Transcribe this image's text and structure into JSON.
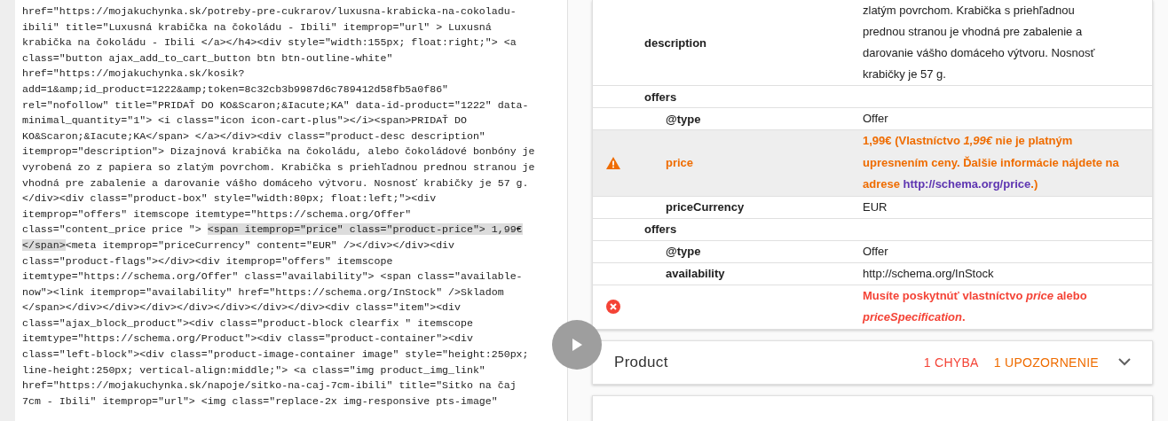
{
  "source_code": {
    "lines": [
      {
        "parts": [
          {
            "text": "href=\"https://mojakuchynka.sk/potreby-pre-cukrarov/luxusna-krabicka-na-cokoladu-",
            "highlighted": false
          }
        ]
      },
      {
        "parts": [
          {
            "text": "ibili\" title=\"Luxusná krabička na čokoládu - Ibili\" itemprop=\"url\" > Luxusná",
            "highlighted": false
          }
        ]
      },
      {
        "parts": [
          {
            "text": "krabička na čokoládu - Ibili </a></h4><div style=\"width:155px; float:right;\"> <a",
            "highlighted": false
          }
        ]
      },
      {
        "parts": [
          {
            "text": "class=\"button ajax_add_to_cart_button btn btn-outline-white\"",
            "highlighted": false
          }
        ]
      },
      {
        "parts": [
          {
            "text": "href=\"https://mojakuchynka.sk/kosik?",
            "highlighted": false
          }
        ]
      },
      {
        "parts": [
          {
            "text": "add=1&amp;id_product=1222&amp;token=8c32cb3b9987d6c789412d58fb5a0f86\"",
            "highlighted": false
          }
        ]
      },
      {
        "parts": [
          {
            "text": "rel=\"nofollow\" title=\"PRIDAŤ DO KO&Scaron;&Iacute;KA\" data-id-product=\"1222\" data-",
            "highlighted": false
          }
        ]
      },
      {
        "parts": [
          {
            "text": "minimal_quantity=\"1\"> <i class=\"icon icon-cart-plus\"></i><span>PRIDAŤ DO",
            "highlighted": false
          }
        ]
      },
      {
        "parts": [
          {
            "text": "KO&Scaron;&Iacute;KA</span> </a></div><div class=\"product-desc description\"",
            "highlighted": false
          }
        ]
      },
      {
        "parts": [
          {
            "text": "itemprop=\"description\"> Dizajnová krabička na čokoládu, alebo čokoládové bonbóny je",
            "highlighted": false
          }
        ]
      },
      {
        "parts": [
          {
            "text": "vyrobená zo z papiera so zlatým povrchom. Krabička s priehľadnou prednou stranou je",
            "highlighted": false
          }
        ]
      },
      {
        "parts": [
          {
            "text": "vhodná pre zabalenie a darovanie vášho domáceho výtvoru. Nosnosť krabičky je 57 g.",
            "highlighted": false
          }
        ]
      },
      {
        "parts": [
          {
            "text": "</div><div class=\"product-box\" style=\"width:80px; float:left;\"><div",
            "highlighted": false
          }
        ]
      },
      {
        "parts": [
          {
            "text": "itemprop=\"offers\" itemscope itemtype=\"https://schema.org/Offer\"",
            "highlighted": false
          }
        ]
      },
      {
        "parts": [
          {
            "text": "class=\"content_price price \"> ",
            "highlighted": false
          },
          {
            "text": "<span itemprop=\"price\" class=\"product-price\"> 1,99€",
            "highlighted": true
          }
        ]
      },
      {
        "parts": [
          {
            "text": "</span>",
            "highlighted": true
          },
          {
            "text": "<meta itemprop=\"priceCurrency\" content=\"EUR\" /></div></div><div",
            "highlighted": false
          }
        ]
      },
      {
        "parts": [
          {
            "text": "class=\"product-flags\"></div><div itemprop=\"offers\" itemscope",
            "highlighted": false
          }
        ]
      },
      {
        "parts": [
          {
            "text": "itemtype=\"https://schema.org/Offer\" class=\"availability\"> <span class=\"available-",
            "highlighted": false
          }
        ]
      },
      {
        "parts": [
          {
            "text": "now\"><link itemprop=\"availability\" href=\"https://schema.org/InStock\" />Skladom",
            "highlighted": false
          }
        ]
      },
      {
        "parts": [
          {
            "text": "</span></div></div></div></div></div></div></div><div class=\"item\"><div",
            "highlighted": false
          }
        ]
      },
      {
        "parts": [
          {
            "text": "class=\"ajax_block_product\"><div class=\"product-block clearfix \" itemscope",
            "highlighted": false
          }
        ]
      },
      {
        "parts": [
          {
            "text": "itemtype=\"https://schema.org/Product\"><div class=\"product-container\"><div",
            "highlighted": false
          }
        ]
      },
      {
        "parts": [
          {
            "text": "class=\"left-block\"><div class=\"product-image-container image\" style=\"height:250px;",
            "highlighted": false
          }
        ]
      },
      {
        "parts": [
          {
            "text": "line-height:250px; vertical-align:middle;\"> <a class=\"img product_img_link\"",
            "highlighted": false
          }
        ]
      },
      {
        "parts": [
          {
            "text": "href=\"https://mojakuchynka.sk/napoje/sitko-na-caj-7cm-ibili\" title=\"Sitko na čaj",
            "highlighted": false
          }
        ]
      },
      {
        "parts": [
          {
            "text": "7cm - Ibili\" itemprop=\"url\"> <img class=\"replace-2x img-responsive pts-image\"",
            "highlighted": false
          }
        ]
      }
    ]
  },
  "results": {
    "rows": [
      {
        "kind": "property",
        "name": "description",
        "value": "zlatým povrchom. Krabička s priehľadnou prednou stranou je vhodná pre zabalenie a darovanie vášho domáceho výtvoru. Nosnosť krabičky je 57 g."
      },
      {
        "kind": "property",
        "name": "offers",
        "children": [
          {
            "kind": "property",
            "name": "@type",
            "value": "Offer"
          },
          {
            "kind": "warning",
            "name": "price",
            "message": "1,99€ (Vlastníctvo *1,99€* nie je platným upresnením ceny. Ďalšie informácie nájdete na adrese",
            "link": "http://schema.org/price",
            "message_end": ".)"
          },
          {
            "kind": "property",
            "name": "priceCurrency",
            "value": "EUR"
          }
        ]
      },
      {
        "kind": "property",
        "name": "offers",
        "children": [
          {
            "kind": "property",
            "name": "@type",
            "value": "Offer"
          },
          {
            "kind": "property",
            "name": "availability",
            "value": "http://schema.org/InStock"
          }
        ]
      },
      {
        "kind": "error",
        "message": "Musíte poskytnúť vlastníctvo *price* alebo *priceSpecification*."
      }
    ]
  },
  "items": [
    {
      "title": "Product",
      "errors": "1 CHYBA",
      "warnings": "1 UPOZORNENIE",
      "expanded": false
    }
  ]
}
